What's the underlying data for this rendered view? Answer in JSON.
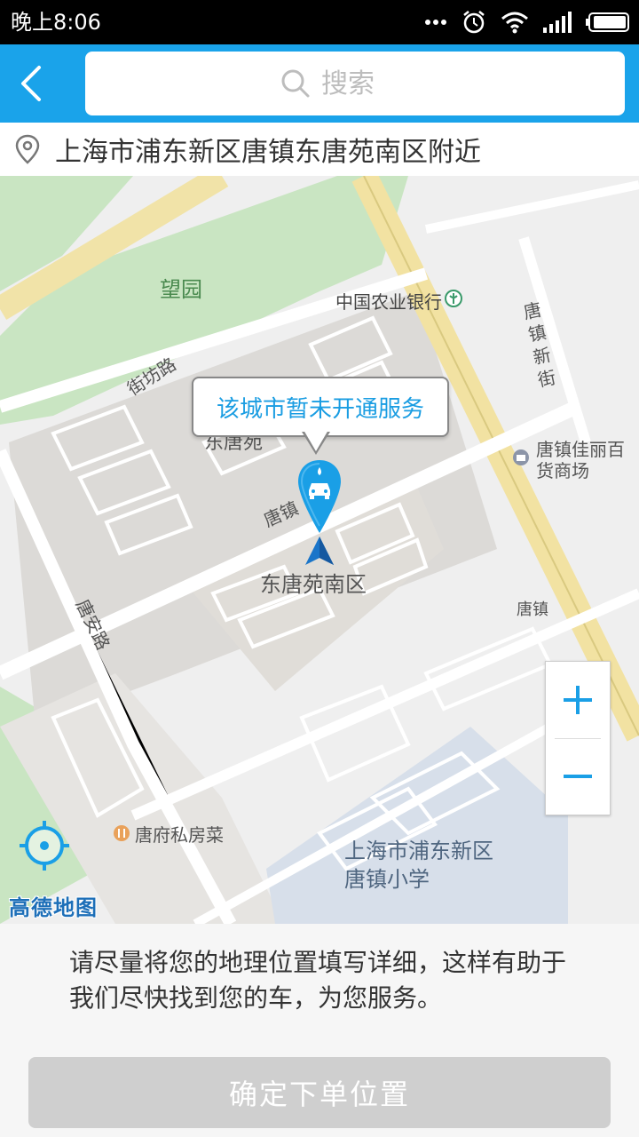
{
  "status_bar": {
    "time": "晚上8:06",
    "icons": [
      "more-dots-icon",
      "alarm-icon",
      "wifi-icon",
      "signal-icon",
      "battery-icon"
    ]
  },
  "header": {
    "back_icon": "chevron-left-icon",
    "search_placeholder": "搜索",
    "search_icon": "search-icon"
  },
  "address": {
    "icon": "location-pin-icon",
    "text": "上海市浦东新区唐镇东唐苑南区附近"
  },
  "map": {
    "labels": {
      "wangyuan": "望园",
      "abc_bank": "中国农业银行",
      "jiefang_road": "街坊路",
      "tangzhen_new_street": "唐镇新街",
      "dongtangyuan": "东唐苑",
      "tangzhen_jiali": "唐镇佳丽百货商场",
      "tangzhen_road": "唐镇",
      "dongtangyuan_south": "东唐苑南区",
      "tangan_road": "唐安路",
      "tangzhen_right": "唐镇",
      "tangfu": "唐府私房菜",
      "school": "上海市浦东新区唐镇小学"
    },
    "callout": "该城市暂未开通服务",
    "marker_icon": "car-wash-marker-icon",
    "zoom_in": "+",
    "zoom_out": "−",
    "locate_icon": "locate-crosshair-icon",
    "provider_logo": "高德地图"
  },
  "footer": {
    "hint": "请尽量将您的地理位置填写详细，这样有助于我们尽快找到您的车，为您服务。",
    "confirm_label": "确定下单位置"
  },
  "colors": {
    "accent": "#1aa3ea",
    "callout_text": "#1a9de2",
    "disabled_button": "#cfcfcf"
  }
}
